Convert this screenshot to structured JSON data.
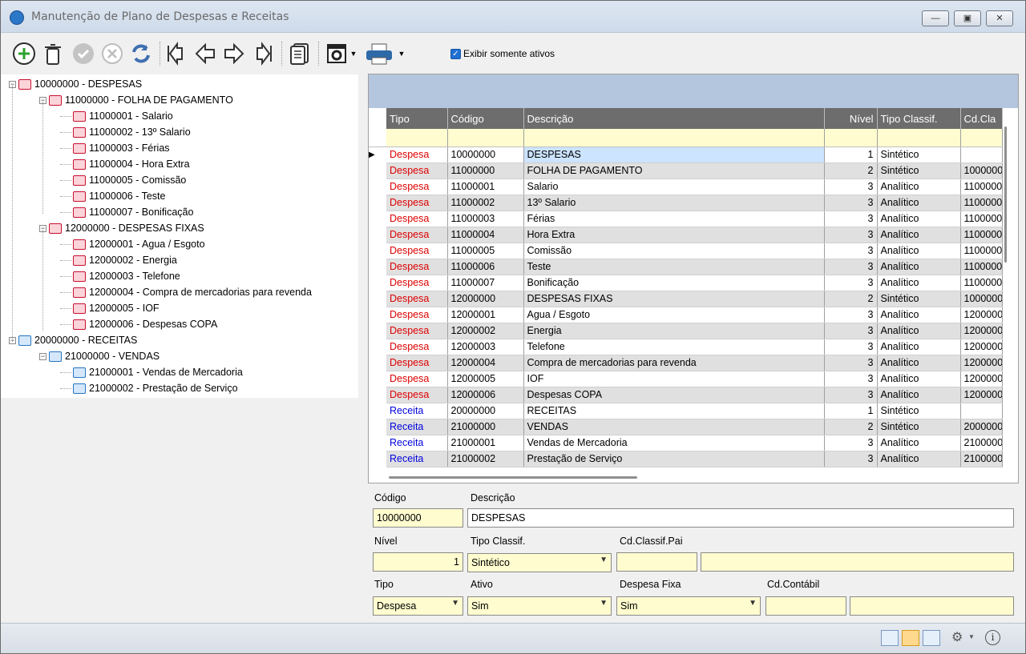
{
  "window": {
    "title": "Manutenção de Plano de Despesas e Receitas"
  },
  "toolbar": {
    "icons": [
      "add-icon",
      "delete-icon",
      "confirm-icon",
      "cancel-icon",
      "refresh-icon",
      "first-icon",
      "previous-icon",
      "next-icon",
      "last-icon",
      "report-icon",
      "settings-icon",
      "print-icon"
    ],
    "only_active_label": "Exibir somente ativos",
    "only_active_checked": true
  },
  "tree": {
    "nodes": [
      {
        "level": 0,
        "label": "10000000 - DESPESAS",
        "type": "despesa",
        "expanded": true
      },
      {
        "level": 1,
        "label": "11000000 - FOLHA DE PAGAMENTO",
        "type": "despesa",
        "expanded": true
      },
      {
        "level": 2,
        "label": "11000001 - Salario",
        "type": "despesa"
      },
      {
        "level": 2,
        "label": "11000002 - 13º Salario",
        "type": "despesa"
      },
      {
        "level": 2,
        "label": "11000003 - Férias",
        "type": "despesa"
      },
      {
        "level": 2,
        "label": "11000004 - Hora Extra",
        "type": "despesa"
      },
      {
        "level": 2,
        "label": "11000005 - Comissão",
        "type": "despesa"
      },
      {
        "level": 2,
        "label": "11000006 - Teste",
        "type": "despesa"
      },
      {
        "level": 2,
        "label": "11000007 - Bonificação",
        "type": "despesa"
      },
      {
        "level": 1,
        "label": "12000000 - DESPESAS FIXAS",
        "type": "despesa",
        "expanded": true
      },
      {
        "level": 2,
        "label": "12000001 - Agua / Esgoto",
        "type": "despesa"
      },
      {
        "level": 2,
        "label": "12000002 - Energia",
        "type": "despesa"
      },
      {
        "level": 2,
        "label": "12000003 - Telefone",
        "type": "despesa"
      },
      {
        "level": 2,
        "label": "12000004 - Compra de mercadorias para revenda",
        "type": "despesa"
      },
      {
        "level": 2,
        "label": "12000005 - IOF",
        "type": "despesa"
      },
      {
        "level": 2,
        "label": "12000006 - Despesas COPA",
        "type": "despesa"
      },
      {
        "level": 0,
        "label": "20000000 - RECEITAS",
        "type": "receita",
        "expanded": true
      },
      {
        "level": 1,
        "label": "21000000 - VENDAS",
        "type": "receita",
        "expanded": true
      },
      {
        "level": 2,
        "label": "21000001 - Vendas de Mercadoria",
        "type": "receita"
      },
      {
        "level": 2,
        "label": "21000002 - Prestação de Serviço",
        "type": "receita"
      }
    ]
  },
  "grid": {
    "columns": [
      "Tipo",
      "Código",
      "Descrição",
      "Nível",
      "Tipo Classif.",
      "Cd.Cla"
    ],
    "rows": [
      [
        "Despesa",
        "10000000",
        "DESPESAS",
        "1",
        "Sintético",
        ""
      ],
      [
        "Despesa",
        "11000000",
        "FOLHA DE PAGAMENTO",
        "2",
        "Sintético",
        "1000000"
      ],
      [
        "Despesa",
        "11000001",
        "Salario",
        "3",
        "Analítico",
        "1100000"
      ],
      [
        "Despesa",
        "11000002",
        "13º Salario",
        "3",
        "Analítico",
        "1100000"
      ],
      [
        "Despesa",
        "11000003",
        "Férias",
        "3",
        "Analítico",
        "1100000"
      ],
      [
        "Despesa",
        "11000004",
        "Hora Extra",
        "3",
        "Analítico",
        "1100000"
      ],
      [
        "Despesa",
        "11000005",
        "Comissão",
        "3",
        "Analítico",
        "1100000"
      ],
      [
        "Despesa",
        "11000006",
        "Teste",
        "3",
        "Analítico",
        "1100000"
      ],
      [
        "Despesa",
        "11000007",
        "Bonificação",
        "3",
        "Analítico",
        "1100000"
      ],
      [
        "Despesa",
        "12000000",
        "DESPESAS FIXAS",
        "2",
        "Sintético",
        "1000000"
      ],
      [
        "Despesa",
        "12000001",
        "Agua / Esgoto",
        "3",
        "Analítico",
        "1200000"
      ],
      [
        "Despesa",
        "12000002",
        "Energia",
        "3",
        "Analítico",
        "1200000"
      ],
      [
        "Despesa",
        "12000003",
        "Telefone",
        "3",
        "Analítico",
        "1200000"
      ],
      [
        "Despesa",
        "12000004",
        "Compra de mercadorias para revenda",
        "3",
        "Analítico",
        "1200000"
      ],
      [
        "Despesa",
        "12000005",
        "IOF",
        "3",
        "Analítico",
        "1200000"
      ],
      [
        "Despesa",
        "12000006",
        "Despesas COPA",
        "3",
        "Analítico",
        "1200000"
      ],
      [
        "Receita",
        "20000000",
        "RECEITAS",
        "1",
        "Sintético",
        ""
      ],
      [
        "Receita",
        "21000000",
        "VENDAS",
        "2",
        "Sintético",
        "2000000"
      ],
      [
        "Receita",
        "21000001",
        "Vendas de Mercadoria",
        "3",
        "Analítico",
        "2100000"
      ],
      [
        "Receita",
        "21000002",
        "Prestação de Serviço",
        "3",
        "Analítico",
        "2100000"
      ]
    ],
    "selected_row": 0
  },
  "form": {
    "codigo_label": "Código",
    "codigo_value": "10000000",
    "descricao_label": "Descrição",
    "descricao_value": "DESPESAS",
    "nivel_label": "Nível",
    "nivel_value": "1",
    "tipo_classif_label": "Tipo Classif.",
    "tipo_classif_value": "Sintético",
    "cd_classif_pai_label": "Cd.Classif.Pai",
    "cd_classif_pai_value": "",
    "cd_classif_pai_desc": "",
    "tipo_label": "Tipo",
    "tipo_value": "Despesa",
    "ativo_label": "Ativo",
    "ativo_value": "Sim",
    "despesa_fixa_label": "Despesa Fixa",
    "despesa_fixa_value": "Sim",
    "cd_contabil_label": "Cd.Contábil",
    "cd_contabil_value": "",
    "cd_contabil_desc": ""
  },
  "colors": {
    "despesa": "#e00000",
    "receita": "#0000e0",
    "filter_row": "#fffccf",
    "header": "#6d6d6d",
    "selection": "#cce4ff"
  }
}
